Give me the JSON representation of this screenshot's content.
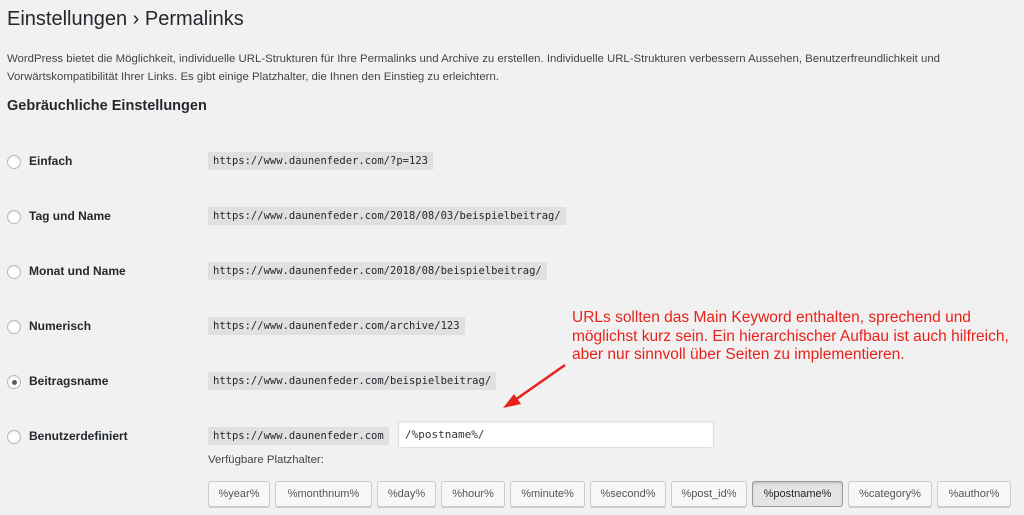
{
  "page": {
    "title": "Einstellungen › Permalinks",
    "intro": "WordPress bietet die Möglichkeit, individuelle URL-Strukturen für Ihre Permalinks und Archive zu erstellen. Individuelle URL-Strukturen verbessern Aussehen, Benutzerfreundlichkeit und Vorwärtskompatibilität Ihrer Links. Es gibt einige Platzhalter, die Ihnen den Einstieg zu erleichtern.",
    "section_title": "Gebräuchliche Einstellungen"
  },
  "options": [
    {
      "label": "Einfach",
      "example": "https://www.daunenfeder.com/?p=123",
      "checked": false
    },
    {
      "label": "Tag und Name",
      "example": "https://www.daunenfeder.com/2018/08/03/beispielbeitrag/",
      "checked": false
    },
    {
      "label": "Monat und Name",
      "example": "https://www.daunenfeder.com/2018/08/beispielbeitrag/",
      "checked": false
    },
    {
      "label": "Numerisch",
      "example": "https://www.daunenfeder.com/archive/123",
      "checked": false
    },
    {
      "label": "Beitragsname",
      "example": "https://www.daunenfeder.com/beispielbeitrag/",
      "checked": true
    },
    {
      "label": "Benutzerdefiniert",
      "example": "https://www.daunenfeder.com",
      "checked": false,
      "input_value": "/%postname%/"
    }
  ],
  "tags": {
    "label": "Verfügbare Platzhalter:",
    "items": [
      "%year%",
      "%monthnum%",
      "%day%",
      "%hour%",
      "%minute%",
      "%second%",
      "%post_id%",
      "%postname%",
      "%category%",
      "%author%"
    ],
    "active": "%postname%"
  },
  "annotation": {
    "text": "URLs sollten das Main Keyword enthalten, sprechend und möglichst kurz sein. Ein hierarchischer Aufbau ist auch hilfreich, aber nur sinnvoll über Seiten zu implementieren.",
    "color": "#e8221b"
  }
}
